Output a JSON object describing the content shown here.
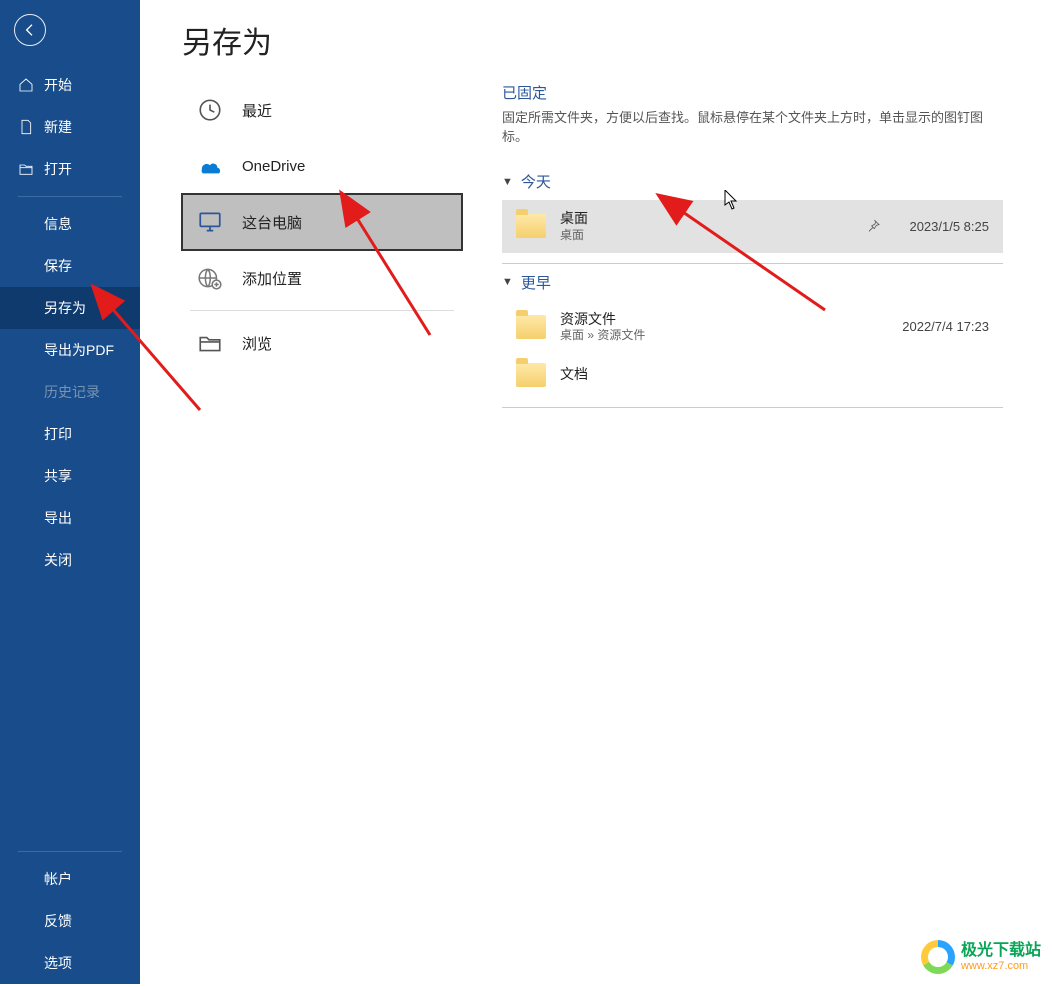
{
  "sidebar": {
    "top": [
      {
        "key": "home",
        "label": "开始",
        "icon": "home"
      },
      {
        "key": "new",
        "label": "新建",
        "icon": "file"
      },
      {
        "key": "open",
        "label": "打开",
        "icon": "open"
      }
    ],
    "mid": [
      {
        "key": "info",
        "label": "信息"
      },
      {
        "key": "save",
        "label": "保存"
      },
      {
        "key": "saveas",
        "label": "另存为",
        "selected": true
      },
      {
        "key": "exportpdf",
        "label": "导出为PDF"
      },
      {
        "key": "history",
        "label": "历史记录",
        "disabled": true
      },
      {
        "key": "print",
        "label": "打印"
      },
      {
        "key": "share",
        "label": "共享"
      },
      {
        "key": "export",
        "label": "导出"
      },
      {
        "key": "close",
        "label": "关闭"
      }
    ],
    "bottom": [
      {
        "key": "account",
        "label": "帐户"
      },
      {
        "key": "feedback",
        "label": "反馈"
      },
      {
        "key": "options",
        "label": "选项"
      }
    ]
  },
  "pageTitle": "另存为",
  "locations": [
    {
      "key": "recent",
      "label": "最近",
      "icon": "clock"
    },
    {
      "key": "onedrive",
      "label": "OneDrive",
      "icon": "onedrive"
    },
    {
      "key": "thispc",
      "label": "这台电脑",
      "icon": "monitor",
      "selected": true
    },
    {
      "key": "addplace",
      "label": "添加位置",
      "icon": "globe-plus"
    },
    {
      "key": "browse",
      "label": "浏览",
      "icon": "folder-open"
    }
  ],
  "pinned": {
    "title": "已固定",
    "desc": "固定所需文件夹，方便以后查找。鼠标悬停在某个文件夹上方时，单击显示的图钉图标。"
  },
  "groups": [
    {
      "label": "今天",
      "items": [
        {
          "name": "桌面",
          "path": "桌面",
          "date": "2023/1/5 8:25",
          "hover": true,
          "pin": true
        }
      ]
    },
    {
      "label": "更早",
      "items": [
        {
          "name": "资源文件",
          "path": "桌面 » 资源文件",
          "date": "2022/7/4 17:23"
        },
        {
          "name": "文档",
          "path": ""
        }
      ]
    }
  ],
  "watermark": {
    "line1": "极光下载站",
    "line2": "www.xz7.com"
  }
}
